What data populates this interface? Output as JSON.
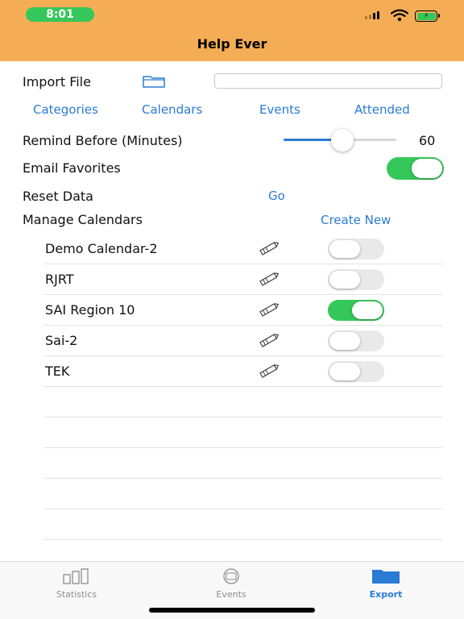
{
  "status_bar": {
    "time": "8:01"
  },
  "nav": {
    "title": "Help Ever"
  },
  "import": {
    "label": "Import File",
    "file_value": ""
  },
  "tabs": [
    "Categories",
    "Calendars",
    "Events",
    "Attended"
  ],
  "remind": {
    "label": "Remind Before (Minutes)",
    "value": "60",
    "slider_fraction": 0.52
  },
  "email_favorites": {
    "label": "Email Favorites",
    "enabled": true
  },
  "reset": {
    "label": "Reset Data",
    "action": "Go"
  },
  "manage": {
    "label": "Manage Calendars",
    "action": "Create New"
  },
  "calendars": [
    {
      "name": "Demo Calendar-2",
      "enabled": false
    },
    {
      "name": "RJRT",
      "enabled": false
    },
    {
      "name": "SAI Region 10",
      "enabled": true
    },
    {
      "name": "Sai-2",
      "enabled": false
    },
    {
      "name": "TEK",
      "enabled": false
    }
  ],
  "tabbar": {
    "statistics": "Statistics",
    "events": "Events",
    "export": "Export"
  },
  "colors": {
    "header": "#f5ad55",
    "accent": "#2a7bd4",
    "toggle_on": "#35c759"
  }
}
